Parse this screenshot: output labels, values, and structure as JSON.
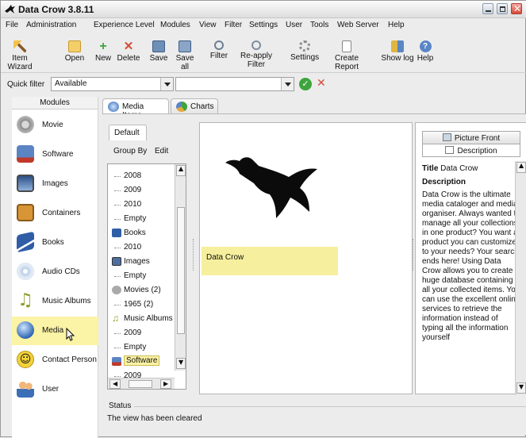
{
  "window": {
    "title": "Data Crow 3.8.11"
  },
  "menu": [
    "File",
    "Administration",
    "Experience Level",
    "Modules",
    "View",
    "Filter",
    "Settings",
    "User",
    "Tools",
    "Web Server",
    "Help"
  ],
  "toolbar": {
    "item_wizard": "Item Wizard",
    "open": "Open",
    "new": "New",
    "delete": "Delete",
    "save": "Save",
    "save_all": "Save all",
    "filter": "Filter",
    "reapply_filter": "Re-apply Filter",
    "settings": "Settings",
    "create_report": "Create Report",
    "show_log": "Show log",
    "help": "Help"
  },
  "filter": {
    "label": "Quick filter",
    "value": "Available",
    "search_value": ""
  },
  "sidebar": {
    "title": "Modules",
    "items": [
      {
        "label": "Movie"
      },
      {
        "label": "Software"
      },
      {
        "label": "Images"
      },
      {
        "label": "Containers"
      },
      {
        "label": "Books"
      },
      {
        "label": "Audio CDs"
      },
      {
        "label": "Music Albums"
      },
      {
        "label": "Media"
      },
      {
        "label": "Contact Person"
      },
      {
        "label": "User"
      }
    ]
  },
  "tabs": {
    "media_items": "Media Items",
    "charts": "Charts"
  },
  "group": {
    "tab": "Default",
    "group_by": "Group By",
    "edit": "Edit"
  },
  "tree": [
    "2008",
    "2009",
    "2010",
    "Empty",
    "Books",
    "2010",
    "Images",
    "Empty",
    "Movies (2)",
    "1965 (2)",
    "Music Albums",
    "2009",
    "Empty",
    "Software",
    "2009"
  ],
  "item": {
    "name": "Data Crow"
  },
  "details": {
    "tab_picture": "Picture Front",
    "tab_description": "Description",
    "title_label": "Title",
    "title_value": "Data Crow",
    "description_label": "Description",
    "description_text": "Data Crow is the ultimate media cataloger and media organiser. Always wanted to manage all your collections in one product? You want a product you can customize to your needs? Your search ends here! Using Data Crow allows you to create a huge database containing all your collected items. You can use the excellent online services to retrieve the information instead of typing all the information yourself"
  },
  "status": {
    "label": "Status",
    "message": "The view has been cleared"
  },
  "colors": {
    "selection": "#fbf3a5",
    "accent_red": "#d6493a",
    "accent_green": "#3ea43e"
  }
}
